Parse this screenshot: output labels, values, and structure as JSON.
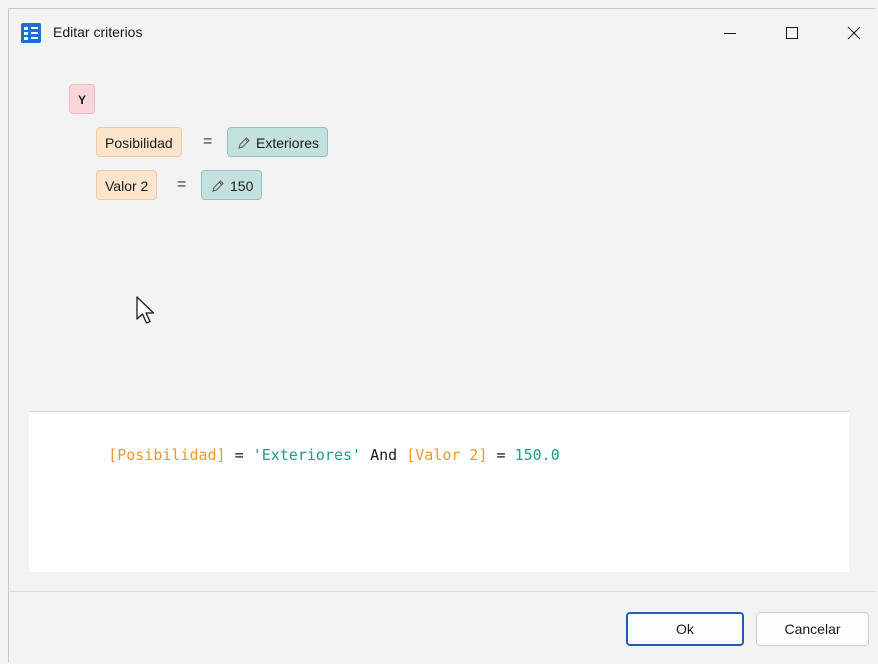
{
  "window": {
    "title": "Editar criterios"
  },
  "tree": {
    "group_operator": "Y",
    "conditions": [
      {
        "field": "Posibilidad",
        "operator": "=",
        "value": "Exteriores"
      },
      {
        "field": "Valor 2",
        "operator": "=",
        "value": "150"
      }
    ]
  },
  "expression": {
    "tokens": [
      {
        "text": "[Posibilidad]",
        "kind": "field"
      },
      {
        "text": " = ",
        "kind": "op"
      },
      {
        "text": "'Exteriores'",
        "kind": "str"
      },
      {
        "text": " And ",
        "kind": "op"
      },
      {
        "text": "[Valor 2]",
        "kind": "field"
      },
      {
        "text": " = ",
        "kind": "op"
      },
      {
        "text": "150.0",
        "kind": "num"
      }
    ]
  },
  "buttons": {
    "ok": "Ok",
    "cancel": "Cancelar"
  },
  "icons": {
    "app": "criteria-editor-icon",
    "minimize": "minimize-icon",
    "maximize": "maximize-icon",
    "close": "close-icon",
    "edit": "pencil-icon",
    "cursor": "mouse-pointer-icon"
  },
  "colors": {
    "group_chip": "#f8d7db",
    "field_chip": "#fde4cd",
    "value_chip": "#c3e2dd",
    "field_token": "#f0962a",
    "value_token": "#1b9e8a",
    "accent": "#1f5fb3"
  }
}
